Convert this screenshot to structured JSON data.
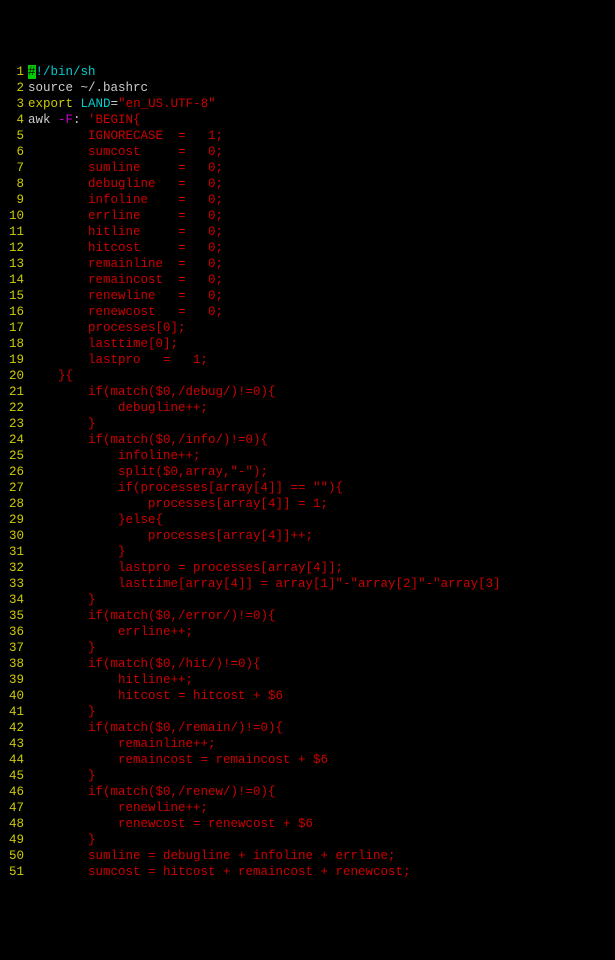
{
  "lines": [
    {
      "n": 1,
      "tokens": [
        {
          "t": "#",
          "c": "cyan",
          "cursor": true
        },
        {
          "t": "!/bin/sh",
          "c": "cyan"
        }
      ]
    },
    {
      "n": 2,
      "tokens": [
        {
          "t": "source ~/.bashrc",
          "c": "white"
        }
      ]
    },
    {
      "n": 3,
      "tokens": [
        {
          "t": "export",
          "c": "yellow"
        },
        {
          "t": " ",
          "c": "white"
        },
        {
          "t": "LAND",
          "c": "cyan"
        },
        {
          "t": "=",
          "c": "white"
        },
        {
          "t": "\"en_US.UTF-8\"",
          "c": "red"
        }
      ]
    },
    {
      "n": 4,
      "tokens": [
        {
          "t": "awk ",
          "c": "white"
        },
        {
          "t": "-F",
          "c": "purple"
        },
        {
          "t": ": ",
          "c": "white"
        },
        {
          "t": "'BEGIN{",
          "c": "red"
        }
      ]
    },
    {
      "n": 5,
      "tokens": [
        {
          "t": "        IGNORECASE  =   1;",
          "c": "red"
        }
      ]
    },
    {
      "n": 6,
      "tokens": [
        {
          "t": "        sumcost     =   0;",
          "c": "red"
        }
      ]
    },
    {
      "n": 7,
      "tokens": [
        {
          "t": "        sumline     =   0;",
          "c": "red"
        }
      ]
    },
    {
      "n": 8,
      "tokens": [
        {
          "t": "        debugline   =   0;",
          "c": "red"
        }
      ]
    },
    {
      "n": 9,
      "tokens": [
        {
          "t": "        infoline    =   0;",
          "c": "red"
        }
      ]
    },
    {
      "n": 10,
      "tokens": [
        {
          "t": "        errline     =   0;",
          "c": "red"
        }
      ]
    },
    {
      "n": 11,
      "tokens": [
        {
          "t": "        hitline     =   0;",
          "c": "red"
        }
      ]
    },
    {
      "n": 12,
      "tokens": [
        {
          "t": "        hitcost     =   0;",
          "c": "red"
        }
      ]
    },
    {
      "n": 13,
      "tokens": [
        {
          "t": "        remainline  =   0;",
          "c": "red"
        }
      ]
    },
    {
      "n": 14,
      "tokens": [
        {
          "t": "        remaincost  =   0;",
          "c": "red"
        }
      ]
    },
    {
      "n": 15,
      "tokens": [
        {
          "t": "        renewline   =   0;",
          "c": "red"
        }
      ]
    },
    {
      "n": 16,
      "tokens": [
        {
          "t": "        renewcost   =   0;",
          "c": "red"
        }
      ]
    },
    {
      "n": 17,
      "tokens": [
        {
          "t": "        processes[0];",
          "c": "red"
        }
      ]
    },
    {
      "n": 18,
      "tokens": [
        {
          "t": "        lasttime[0];",
          "c": "red"
        }
      ]
    },
    {
      "n": 19,
      "tokens": [
        {
          "t": "        lastpro   =   1;",
          "c": "red"
        }
      ]
    },
    {
      "n": 20,
      "tokens": [
        {
          "t": "    }{",
          "c": "red"
        }
      ]
    },
    {
      "n": 21,
      "tokens": [
        {
          "t": "        if(match($0,/debug/)!=0){",
          "c": "red"
        }
      ]
    },
    {
      "n": 22,
      "tokens": [
        {
          "t": "            debugline++;",
          "c": "red"
        }
      ]
    },
    {
      "n": 23,
      "tokens": [
        {
          "t": "        }",
          "c": "red"
        }
      ]
    },
    {
      "n": 24,
      "tokens": [
        {
          "t": "        if(match($0,/info/)!=0){",
          "c": "red"
        }
      ]
    },
    {
      "n": 25,
      "tokens": [
        {
          "t": "            infoline++;",
          "c": "red"
        }
      ]
    },
    {
      "n": 26,
      "tokens": [
        {
          "t": "            split($0,array,\"-\");",
          "c": "red"
        }
      ]
    },
    {
      "n": 27,
      "tokens": [
        {
          "t": "            if(processes[array[4]] == \"\"){",
          "c": "red"
        }
      ]
    },
    {
      "n": 28,
      "tokens": [
        {
          "t": "                processes[array[4]] = 1;",
          "c": "red"
        }
      ]
    },
    {
      "n": 29,
      "tokens": [
        {
          "t": "            }else{",
          "c": "red"
        }
      ]
    },
    {
      "n": 30,
      "tokens": [
        {
          "t": "                processes[array[4]]++;",
          "c": "red"
        }
      ]
    },
    {
      "n": 31,
      "tokens": [
        {
          "t": "            }",
          "c": "red"
        }
      ]
    },
    {
      "n": 32,
      "tokens": [
        {
          "t": "            lastpro = processes[array[4]];",
          "c": "red"
        }
      ]
    },
    {
      "n": 33,
      "tokens": [
        {
          "t": "            lasttime[array[4]] = array[1]\"-\"array[2]\"-\"array[3]",
          "c": "red"
        }
      ]
    },
    {
      "n": 34,
      "tokens": [
        {
          "t": "        }",
          "c": "red"
        }
      ]
    },
    {
      "n": 35,
      "tokens": [
        {
          "t": "        if(match($0,/error/)!=0){",
          "c": "red"
        }
      ]
    },
    {
      "n": 36,
      "tokens": [
        {
          "t": "            errline++;",
          "c": "red"
        }
      ]
    },
    {
      "n": 37,
      "tokens": [
        {
          "t": "        }",
          "c": "red"
        }
      ]
    },
    {
      "n": 38,
      "tokens": [
        {
          "t": "        if(match($0,/hit/)!=0){",
          "c": "red"
        }
      ]
    },
    {
      "n": 39,
      "tokens": [
        {
          "t": "            hitline++;",
          "c": "red"
        }
      ]
    },
    {
      "n": 40,
      "tokens": [
        {
          "t": "            hitcost = hitcost + $6",
          "c": "red"
        }
      ]
    },
    {
      "n": 41,
      "tokens": [
        {
          "t": "        }",
          "c": "red"
        }
      ]
    },
    {
      "n": 42,
      "tokens": [
        {
          "t": "        if(match($0,/remain/)!=0){",
          "c": "red"
        }
      ]
    },
    {
      "n": 43,
      "tokens": [
        {
          "t": "            remainline++;",
          "c": "red"
        }
      ]
    },
    {
      "n": 44,
      "tokens": [
        {
          "t": "            remaincost = remaincost + $6",
          "c": "red"
        }
      ]
    },
    {
      "n": 45,
      "tokens": [
        {
          "t": "        }",
          "c": "red"
        }
      ]
    },
    {
      "n": 46,
      "tokens": [
        {
          "t": "        if(match($0,/renew/)!=0){",
          "c": "red"
        }
      ]
    },
    {
      "n": 47,
      "tokens": [
        {
          "t": "            renewline++;",
          "c": "red"
        }
      ]
    },
    {
      "n": 48,
      "tokens": [
        {
          "t": "            renewcost = renewcost + $6",
          "c": "red"
        }
      ]
    },
    {
      "n": 49,
      "tokens": [
        {
          "t": "        }",
          "c": "red"
        }
      ]
    },
    {
      "n": 50,
      "tokens": [
        {
          "t": "        sumline = debugline + infoline + errline;",
          "c": "red"
        }
      ]
    },
    {
      "n": 51,
      "tokens": [
        {
          "t": "        sumcost = hitcost + remaincost + renewcost;",
          "c": "red"
        }
      ]
    }
  ]
}
